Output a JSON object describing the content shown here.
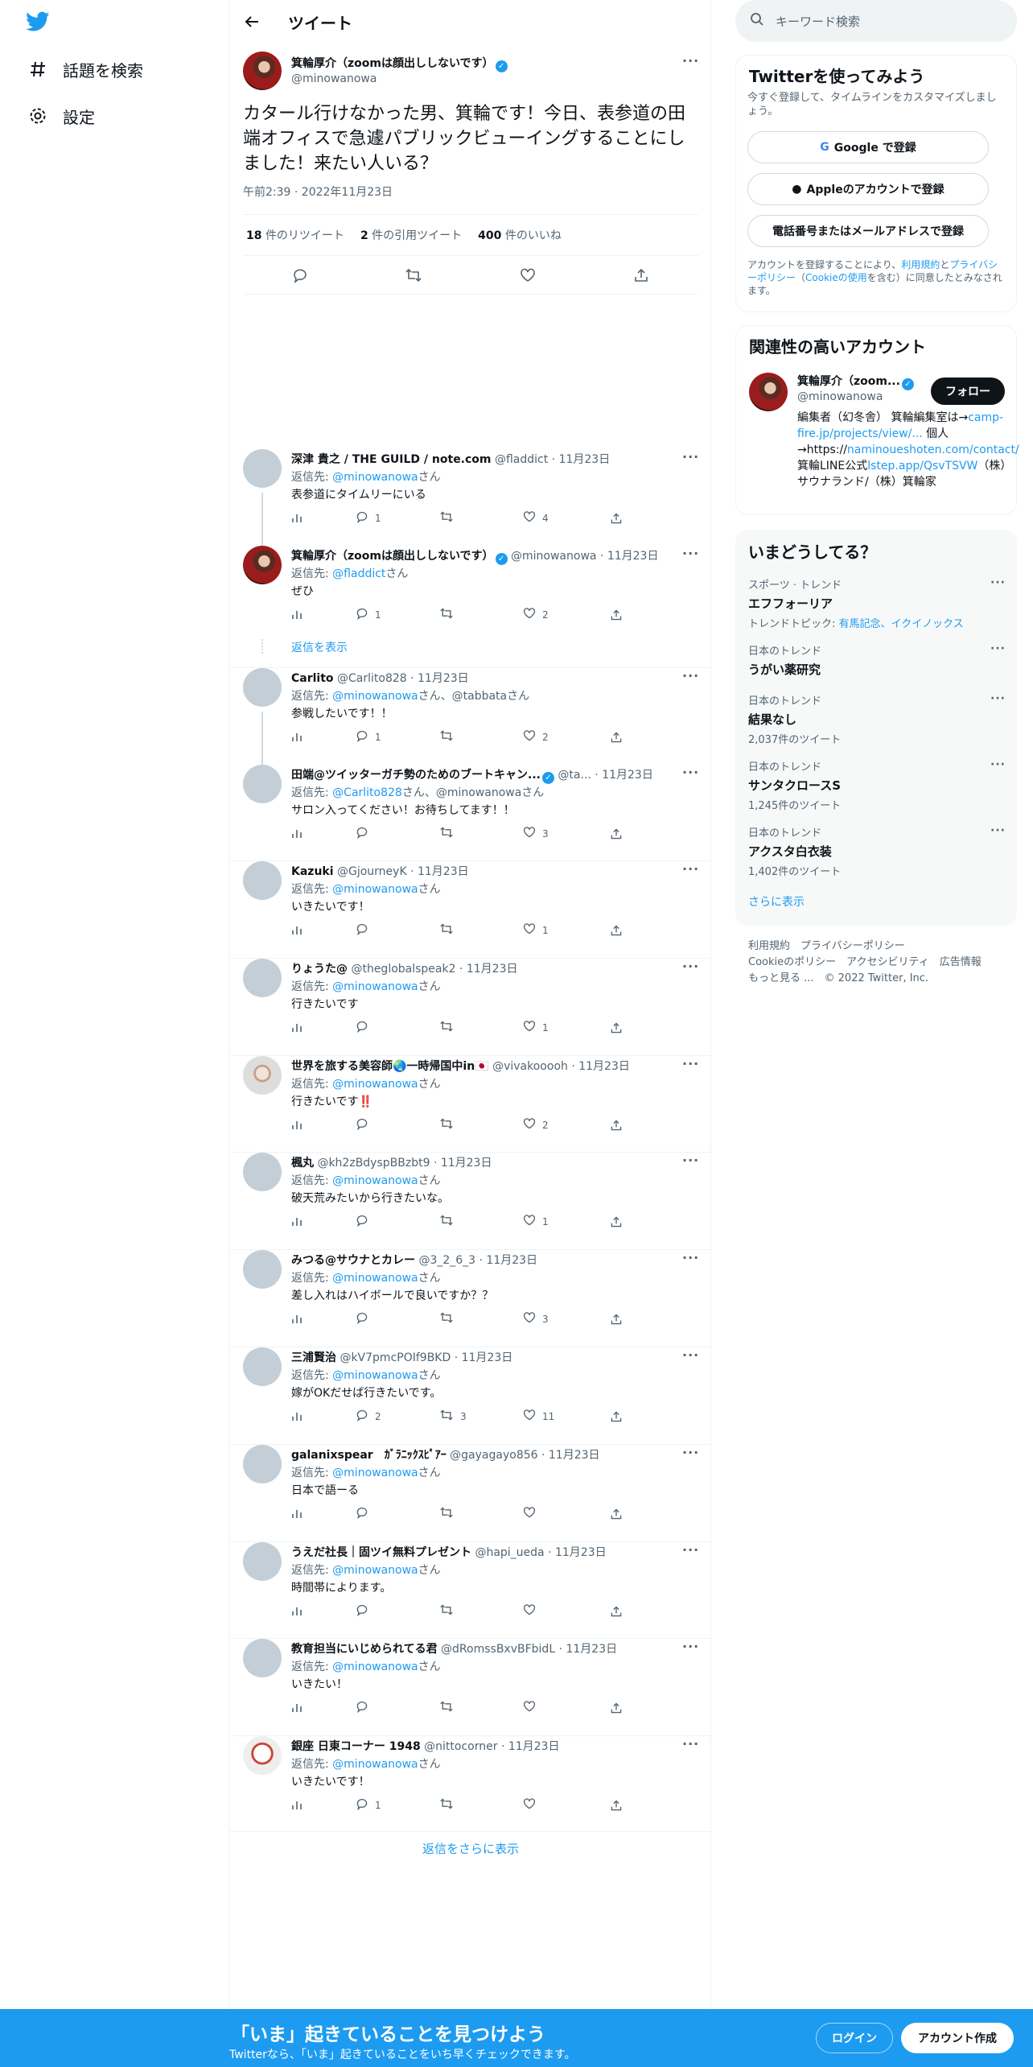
{
  "nav": {
    "explore": "話題を検索",
    "settings": "設定"
  },
  "header": {
    "title": "ツイート"
  },
  "tweet": {
    "name": "箕輪厚介（zoomは顔出ししないです）",
    "handle": "@minowanowa",
    "text": "カタール行けなかった男、箕輪です！今日、表参道の田端オフィスで急遽パブリックビューイングすることにしました！来たい人いる？",
    "time": "午前2:39 · 2022年11月23日",
    "retweets_n": "18",
    "retweets_l": "件のリツイート",
    "quotes_n": "2",
    "quotes_l": "件の引用ツイート",
    "likes_n": "400",
    "likes_l": "件のいいね"
  },
  "replies": [
    {
      "name": "深津 貴之 / THE GUILD / note.com",
      "handle": "@fladdict · 11月23日",
      "to_pre": "返信先: ",
      "to": "@minowanowa",
      "to_post": "さん",
      "text": "表参道にタイムリーにいる",
      "reply": "1",
      "rt": "",
      "like": "4"
    },
    {
      "name": "箕輪厚介（zoomは顔出ししないです）",
      "handle": "@minowanowa · 11月23日",
      "to_pre": "返信先: ",
      "to": "@fladdict",
      "to_post": "さん",
      "text": "ぜひ",
      "reply": "1",
      "rt": "",
      "like": "2"
    },
    {
      "name": "Carlito",
      "handle": "@Carlito828 · 11月23日",
      "to_pre": "返信先: ",
      "to": "@minowanowa",
      "to_post": "さん、@tabbataさん",
      "text": "参戦したいです！！",
      "reply": "1",
      "rt": "",
      "like": "2"
    },
    {
      "name": "田端@ツイッターガチ勢のためのブートキャン...",
      "handle": "@ta... · 11月23日",
      "to_pre": "返信先: ",
      "to": "@Carlito828",
      "to_post": "さん、@minowanowaさん",
      "text": "サロン入ってください！お待ちしてます！！",
      "reply": "",
      "rt": "",
      "like": "3"
    },
    {
      "name": "Kazuki",
      "handle": "@GjourneyK · 11月23日",
      "to_pre": "返信先: ",
      "to": "@minowanowa",
      "to_post": "さん",
      "text": "いきたいです！",
      "reply": "",
      "rt": "",
      "like": "1"
    },
    {
      "name": "りょうた@",
      "handle": "@theglobalspeak2 · 11月23日",
      "to_pre": "返信先: ",
      "to": "@minowanowa",
      "to_post": "さん",
      "text": "行きたいです",
      "reply": "",
      "rt": "",
      "like": "1"
    },
    {
      "name": "世界を旅する美容師🌏一時帰国中in🇯🇵",
      "handle": "@vivakooooh · 11月23日",
      "to_pre": "返信先: ",
      "to": "@minowanowa",
      "to_post": "さん",
      "text": "行きたいです‼️",
      "reply": "",
      "rt": "",
      "like": "2"
    },
    {
      "name": "楓丸",
      "handle": "@kh2zBdyspBBzbt9 · 11月23日",
      "to_pre": "返信先: ",
      "to": "@minowanowa",
      "to_post": "さん",
      "text": "破天荒みたいから行きたいな。",
      "reply": "",
      "rt": "",
      "like": "1"
    },
    {
      "name": "みつる@サウナとカレー",
      "handle": "@3_2_6_3 · 11月23日",
      "to_pre": "返信先: ",
      "to": "@minowanowa",
      "to_post": "さん",
      "text": "差し入れはハイボールで良いですか？？",
      "reply": "",
      "rt": "",
      "like": "3"
    },
    {
      "name": "三浦賢治",
      "handle": "@kV7pmcPOIf9BKD · 11月23日",
      "to_pre": "返信先: ",
      "to": "@minowanowa",
      "to_post": "さん",
      "text": "嫁がOKだせば行きたいです。",
      "reply": "2",
      "rt": "3",
      "like": "11"
    },
    {
      "name": "galanixspear　ｶﾞﾗﾆｯｸｽﾋﾟｱｰ",
      "handle": "@gayagayo856 · 11月23日",
      "to_pre": "返信先: ",
      "to": "@minowanowa",
      "to_post": "さん",
      "text": "日本で語ーる",
      "reply": "",
      "rt": "",
      "like": ""
    },
    {
      "name": "うえだ社長｜固ツイ無料プレゼント",
      "handle": "@hapi_ueda · 11月23日",
      "to_pre": "返信先: ",
      "to": "@minowanowa",
      "to_post": "さん",
      "text": "時間帯によります。",
      "reply": "",
      "rt": "",
      "like": ""
    },
    {
      "name": "教育担当にいじめられてる君",
      "handle": "@dRomssBxvBFbidL · 11月23日",
      "to_pre": "返信先: ",
      "to": "@minowanowa",
      "to_post": "さん",
      "text": "いきたい！",
      "reply": "",
      "rt": "",
      "like": ""
    },
    {
      "name": "銀座 日東コーナー 1948",
      "handle": "@nittocorner · 11月23日",
      "to_pre": "返信先: ",
      "to": "@minowanowa",
      "to_post": "さん",
      "text": "いきたいです！",
      "reply": "1",
      "rt": "",
      "like": ""
    }
  ],
  "show_replies": "返信を表示",
  "more_replies": "返信をさらに表示",
  "search": {
    "placeholder": "キーワード検索"
  },
  "signup": {
    "title": "Twitterを使ってみよう",
    "sub": "今すぐ登録して、タイムラインをカスタマイズしましょう。",
    "google": "Google で登録",
    "apple": "Appleのアカウントで登録",
    "phone": "電話番号またはメールアドレスで登録",
    "terms_a": "アカウントを登録することにより、",
    "terms_b": "利用規約",
    "terms_c": "と",
    "terms_d": "プライバシーポリシー",
    "terms_e": "（",
    "terms_f": "Cookieの使用",
    "terms_g": "を含む）に同意したとみなされます。"
  },
  "related": {
    "title": "関連性の高いアカウント",
    "name": "箕輪厚介（zoom...",
    "handle": "@minowanowa",
    "follow": "フォロー",
    "bio1": "編集者（幻冬舎） 箕輪編集室は→",
    "bio2": "camp-fire.jp/projects/view/...",
    "bio3": " 個人→https://",
    "bio4": "naminoueshoten.com/contact/",
    "bio5": " 箕輪LINE公式",
    "bio6": "lstep.app/QsvTSVW",
    "bio7": "（株）サウナランド/（株）箕輪家"
  },
  "trends": {
    "title": "いまどうしてる？",
    "items": [
      {
        "cat": "スポーツ · トレンド",
        "t": "エフフォーリア",
        "s_pre": "トレンドトピック: ",
        "s_link": "有馬記念、イクイノックス"
      },
      {
        "cat": "日本のトレンド",
        "t": "うがい薬研究",
        "s": ""
      },
      {
        "cat": "日本のトレンド",
        "t": "結果なし",
        "s": "2,037件のツイート"
      },
      {
        "cat": "日本のトレンド",
        "t": "サンタクロースS",
        "s": "1,245件のツイート"
      },
      {
        "cat": "日本のトレンド",
        "t": "アクスタ白衣装",
        "s": "1,402件のツイート"
      }
    ],
    "more": "さらに表示"
  },
  "footer": {
    "l1": "利用規約　プライバシーポリシー",
    "l2": "Cookieのポリシー　アクセシビリティ　広告情報",
    "l3": "もっと見る ...　© 2022 Twitter, Inc."
  },
  "bottom": {
    "title": "「いま」起きていることを見つけよう",
    "sub": "Twitterなら、「いま」起きていることをいち早くチェックできます。",
    "login": "ログイン",
    "signup": "アカウント作成"
  }
}
